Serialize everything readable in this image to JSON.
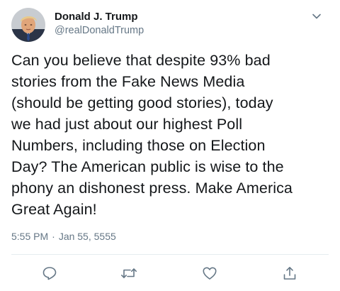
{
  "tweet": {
    "display_name": "Donald J. Trump",
    "handle": "@realDonaldTrump",
    "text": "Can you believe that despite 93% bad\nstories from the Fake News Media\n(should be getting good stories), today\nwe had just about our highest Poll\nNumbers, including those on Election\nDay? The American public is wise to the\nphony an dishonest press. Make America\nGreat Again!",
    "time": "5:55 PM",
    "separator": "·",
    "date": "Jan 55, 5555"
  },
  "icons": {
    "avatar": "profile-photo",
    "menu": "chevron-down-icon",
    "reply": "reply-icon",
    "retweet": "retweet-icon",
    "like": "heart-icon",
    "share": "share-icon"
  },
  "colors": {
    "text": "#14171a",
    "secondary": "#657786",
    "icon": "#657786",
    "divider": "#e6ecf0"
  }
}
